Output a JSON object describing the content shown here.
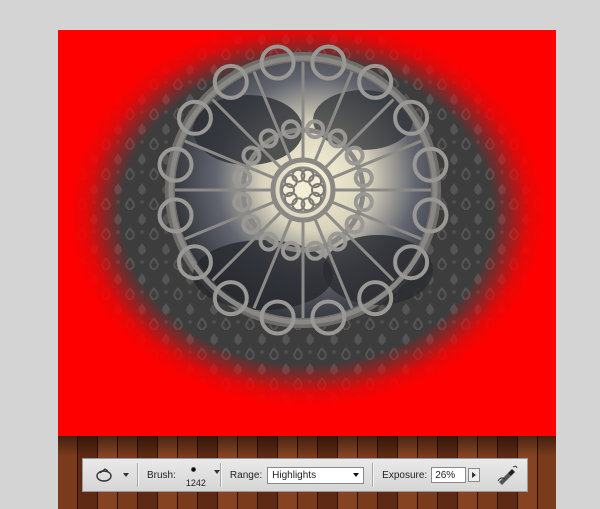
{
  "options_bar": {
    "tool_preset_icon": "dodge-tool-icon",
    "brush_label": "Brush:",
    "brush_size": "1242",
    "range_label": "Range:",
    "range_value": "Highlights",
    "exposure_label": "Exposure:",
    "exposure_value": "26%",
    "airbrush_icon": "airbrush-icon"
  },
  "colors": {
    "mask_red": "#ff0000",
    "wallpaper_dark": "#3f3f3f",
    "wood_dark": "#5a2a14",
    "wood_light": "#8a4a28",
    "sky_light": "#f2ebcf",
    "sky_dark": "#2b2d33"
  }
}
